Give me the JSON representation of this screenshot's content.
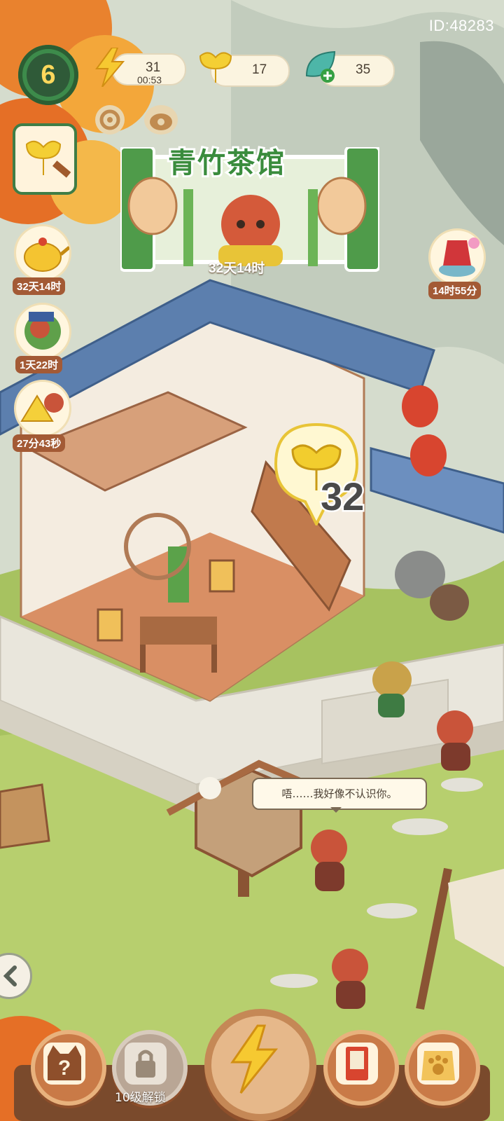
{
  "hud": {
    "player_id": "ID:48283",
    "level": "6",
    "energy": {
      "value": "31",
      "timer": "00:53",
      "icon": "lightning-icon"
    },
    "ginkgo": {
      "value": "17",
      "icon": "ginkgo-leaf-icon"
    },
    "gems": {
      "value": "35",
      "icon": "leaf-gem-icon"
    }
  },
  "shop_sign": {
    "title": "青竹茶馆",
    "timer": "32天14时"
  },
  "left_events": [
    {
      "icon": "golden-teapot-icon",
      "timer": "32天14时"
    },
    {
      "icon": "red-panda-event-icon",
      "timer": "1天22时"
    },
    {
      "icon": "gold-bars-icon",
      "timer": "27分43秒"
    }
  ],
  "right_event": {
    "icon": "red-cloak-well-icon",
    "timer": "14时55分"
  },
  "ginkgo_reward": {
    "value": "32"
  },
  "speech_bubble": "唔……我好像不认识你。",
  "bottom_bar": {
    "locked_label": "10级解锁"
  },
  "colors": {
    "grass": "#b9cf6f",
    "roof": "#5c7fae",
    "wood": "#c97a47",
    "accent_green": "#3a8c3d"
  }
}
